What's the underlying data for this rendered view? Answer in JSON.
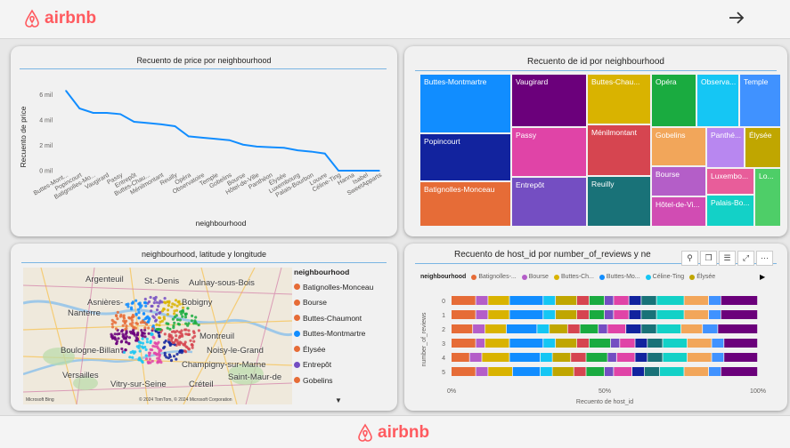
{
  "brand": {
    "name": "airbnb",
    "color": "#ff5a5f"
  },
  "nav": {
    "next_icon": "arrow-right-icon"
  },
  "line_chart": {
    "title": "Recuento de price por neighbourhood",
    "xlabel": "neighbourhood",
    "ylabel": "Recuento de price",
    "y_ticks": [
      "6 mil",
      "4 mil",
      "2 mil",
      "0 mil"
    ]
  },
  "chart_data": [
    {
      "type": "line",
      "title": "Recuento de price por neighbourhood",
      "xlabel": "neighbourhood",
      "ylabel": "Recuento de price",
      "ylim": [
        0,
        7000
      ],
      "categories": [
        "Buttes-Mont...",
        "Popincourt",
        "Batignolles-Mo...",
        "Vaugirard",
        "Passy",
        "Entrepôt",
        "Buttes-Chau...",
        "Ménilmontant",
        "Reuilly",
        "Opéra",
        "Observatoire",
        "Temple",
        "Gobelins",
        "Bourse",
        "Hôtel-de-Ville",
        "Panthéon",
        "Élysée",
        "Luxembourg",
        "Palais-Bourbon",
        "Louvre",
        "Céline-Ting",
        "Hanna",
        "Isabel",
        "SweetApparts"
      ],
      "values": [
        6300,
        4900,
        4550,
        4550,
        4450,
        3850,
        3750,
        3650,
        3500,
        2700,
        2600,
        2500,
        2400,
        2050,
        1900,
        1850,
        1800,
        1600,
        1500,
        1350,
        0,
        0,
        0,
        0
      ],
      "color": "#118dff"
    },
    {
      "type": "treemap",
      "title": "Recuento de id por neighbourhood",
      "categories": [
        "Buttes-Montmartre",
        "Popincourt",
        "Batignolles-Monceau",
        "Vaugirard",
        "Passy",
        "Entrepôt",
        "Buttes-Chau...",
        "Ménilmontant",
        "Reuilly",
        "Opéra",
        "Gobelins",
        "Bourse",
        "Hôtel-de-Vi...",
        "Observa...",
        "Temple",
        "Panthé...",
        "Élysée",
        "Luxembo...",
        "Palais-Bo...",
        "Lo..."
      ]
    },
    {
      "type": "bar",
      "title": "Recuento de host_id por number_of_reviews y ne",
      "xlabel": "Recuento de host_id",
      "ylabel": "number_of_reviews",
      "categories": [
        "0",
        "1",
        "2",
        "3",
        "4",
        "5"
      ],
      "x_ticks": [
        "0%",
        "50%",
        "100%"
      ],
      "stacked_percent": true
    }
  ],
  "treemap": {
    "title": "Recuento de id por neighbourhood",
    "tiles": [
      {
        "label": "Buttes-Montmartre",
        "color": "#118dff"
      },
      {
        "label": "Popincourt",
        "color": "#12239e"
      },
      {
        "label": "Batignolles-Monceau",
        "color": "#e66c37"
      },
      {
        "label": "Vaugirard",
        "color": "#6b007b"
      },
      {
        "label": "Passy",
        "color": "#e044a7"
      },
      {
        "label": "Entrepôt",
        "color": "#744ec2"
      },
      {
        "label": "Buttes-Chau...",
        "color": "#d9b300"
      },
      {
        "label": "Ménilmontant",
        "color": "#d64550"
      },
      {
        "label": "Reuilly",
        "color": "#197278"
      },
      {
        "label": "Opéra",
        "color": "#1aab40"
      },
      {
        "label": "Gobelins",
        "color": "#f2a65a"
      },
      {
        "label": "Bourse",
        "color": "#b45ec8"
      },
      {
        "label": "Hôtel-de-Vi...",
        "color": "#d14cb3"
      },
      {
        "label": "Observa...",
        "color": "#15c6f4"
      },
      {
        "label": "Temple",
        "color": "#4092ff"
      },
      {
        "label": "Panthé...",
        "color": "#b887f0"
      },
      {
        "label": "Élysée",
        "color": "#c0a600"
      },
      {
        "label": "Luxembo...",
        "color": "#e85d9a"
      },
      {
        "label": "Palais-Bo...",
        "color": "#13d1c7"
      },
      {
        "label": "Lo...",
        "color": "#4ece68"
      }
    ]
  },
  "map": {
    "title": "neighbourhood, latitude y longitude",
    "place_labels": [
      "Argenteuil",
      "St.-Denis",
      "Aulnay-sous-Bois",
      "Asnières-",
      "Bobigny",
      "Nanterre",
      "Montreuil",
      "Boulogne-Billan",
      "Noisy-le-Grand",
      "Champigny-sur-Marne",
      "Versailles",
      "Vitry-sur-Seine",
      "Créteil",
      "Saint-Maur-de"
    ],
    "attribution": "© 2024 TomTom, © 2024 Microsoft Corporation",
    "bing": "Microsoft Bing",
    "legend_title": "neighbourhood",
    "legend": [
      {
        "label": "Batignolles-Monceau",
        "color": "#e66c37"
      },
      {
        "label": "Bourse",
        "color": "#e66c37"
      },
      {
        "label": "Buttes-Chaumont",
        "color": "#e66c37"
      },
      {
        "label": "Buttes-Montmartre",
        "color": "#118dff"
      },
      {
        "label": "Élysée",
        "color": "#e66c37"
      },
      {
        "label": "Entrepôt",
        "color": "#744ec2"
      },
      {
        "label": "Gobelins",
        "color": "#e66c37"
      }
    ]
  },
  "bar_chart": {
    "title": "Recuento de host_id por number_of_reviews y ne",
    "legend_title": "neighbourhood",
    "legend": [
      {
        "label": "Batignolles-...",
        "color": "#e66c37"
      },
      {
        "label": "Bourse",
        "color": "#b45ec8"
      },
      {
        "label": "Buttes-Ch...",
        "color": "#d9b300"
      },
      {
        "label": "Buttes-Mo...",
        "color": "#118dff"
      },
      {
        "label": "Céline-Ting",
        "color": "#15c6f4"
      },
      {
        "label": "Élysée",
        "color": "#c0a600"
      }
    ],
    "rows": [
      "0",
      "1",
      "2",
      "3",
      "4",
      "5"
    ],
    "x_ticks": [
      "0%",
      "50%",
      "100%"
    ],
    "xlabel": "Recuento de host_id",
    "ylabel": "number_of_reviews"
  }
}
